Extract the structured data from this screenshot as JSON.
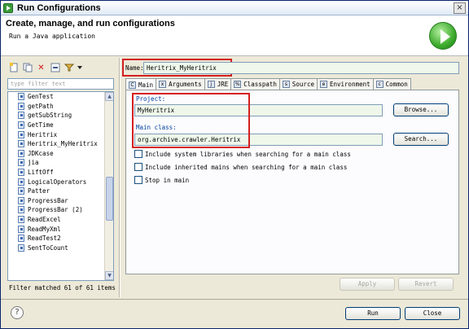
{
  "window": {
    "title": "Run Configurations",
    "close_glyph": "×"
  },
  "banner": {
    "headline": "Create, manage, and run configurations",
    "subline": "Run a Java application",
    "graphic_icon": "run-icon"
  },
  "left": {
    "toolbar_icons": [
      "new-config-icon",
      "duplicate-icon",
      "delete-icon",
      "collapse-icon",
      "filter-icon",
      "dropdown-arrow-icon"
    ],
    "filter_placeholder": "type filter text",
    "items": [
      {
        "label": "GenTest"
      },
      {
        "label": "getPath"
      },
      {
        "label": "getSubString"
      },
      {
        "label": "GetTime"
      },
      {
        "label": "Heritrix"
      },
      {
        "label": "Heritrix_MyHeritrix"
      },
      {
        "label": "JDKcase"
      },
      {
        "label": "jia"
      },
      {
        "label": "LiftOff"
      },
      {
        "label": "LogicalOperators"
      },
      {
        "label": "Patter"
      },
      {
        "label": "ProgressBar"
      },
      {
        "label": "ProgressBar (2)"
      },
      {
        "label": "ReadExcel"
      },
      {
        "label": "ReadMyXml"
      },
      {
        "label": "ReadTest2"
      },
      {
        "label": "SentToCount"
      }
    ],
    "status": "Filter matched 61 of 61 items"
  },
  "right": {
    "name_label": "Name:",
    "name_value": "Heritrix_MyHeritrix",
    "tabs": [
      {
        "label": "Main",
        "icon": "main-tab-icon"
      },
      {
        "label": "Arguments",
        "icon": "arguments-icon"
      },
      {
        "label": "JRE",
        "icon": "jre-icon"
      },
      {
        "label": "Classpath",
        "icon": "classpath-icon"
      },
      {
        "label": "Source",
        "icon": "source-icon"
      },
      {
        "label": "Environment",
        "icon": "environment-icon"
      },
      {
        "label": "Common",
        "icon": "common-icon"
      }
    ],
    "project_label": "Project:",
    "project_value": "MyHeritrix",
    "browse_label": "Browse...",
    "main_class_label": "Main class:",
    "main_class_value": "org.archive.crawler.Heritrix",
    "search_label": "Search...",
    "checks": [
      {
        "label": "Include system libraries when searching for a main class",
        "checked": false
      },
      {
        "label": "Include inherited mains when searching for a main class",
        "checked": false
      },
      {
        "label": "Stop in main",
        "checked": false
      }
    ],
    "apply_label": "Apply",
    "revert_label": "Revert"
  },
  "footer": {
    "help_glyph": "?",
    "run_label": "Run",
    "close_label": "Close"
  },
  "colors": {
    "highlight": "#d42020",
    "field_bg": "#eef7ea",
    "accent": "#0040a0"
  }
}
